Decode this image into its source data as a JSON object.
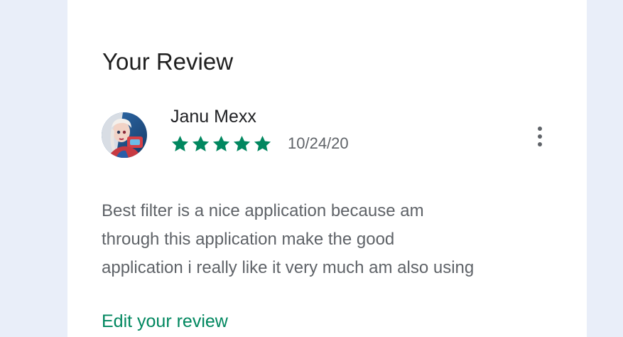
{
  "section": {
    "title": "Your Review"
  },
  "review": {
    "reviewer_name": "Janu Mexx",
    "rating": 5,
    "rating_max": 5,
    "date": "10/24/20",
    "text": "Best filter is a nice application because am\nthrough this application make the good\napplication i really like it very much am also using"
  },
  "actions": {
    "edit_label": "Edit your review",
    "more_icon": "more-vert-icon"
  },
  "colors": {
    "accent": "#01875f",
    "star": "#01875f",
    "background": "#e9eef9",
    "card": "#ffffff",
    "secondary_text": "#5f6368"
  }
}
